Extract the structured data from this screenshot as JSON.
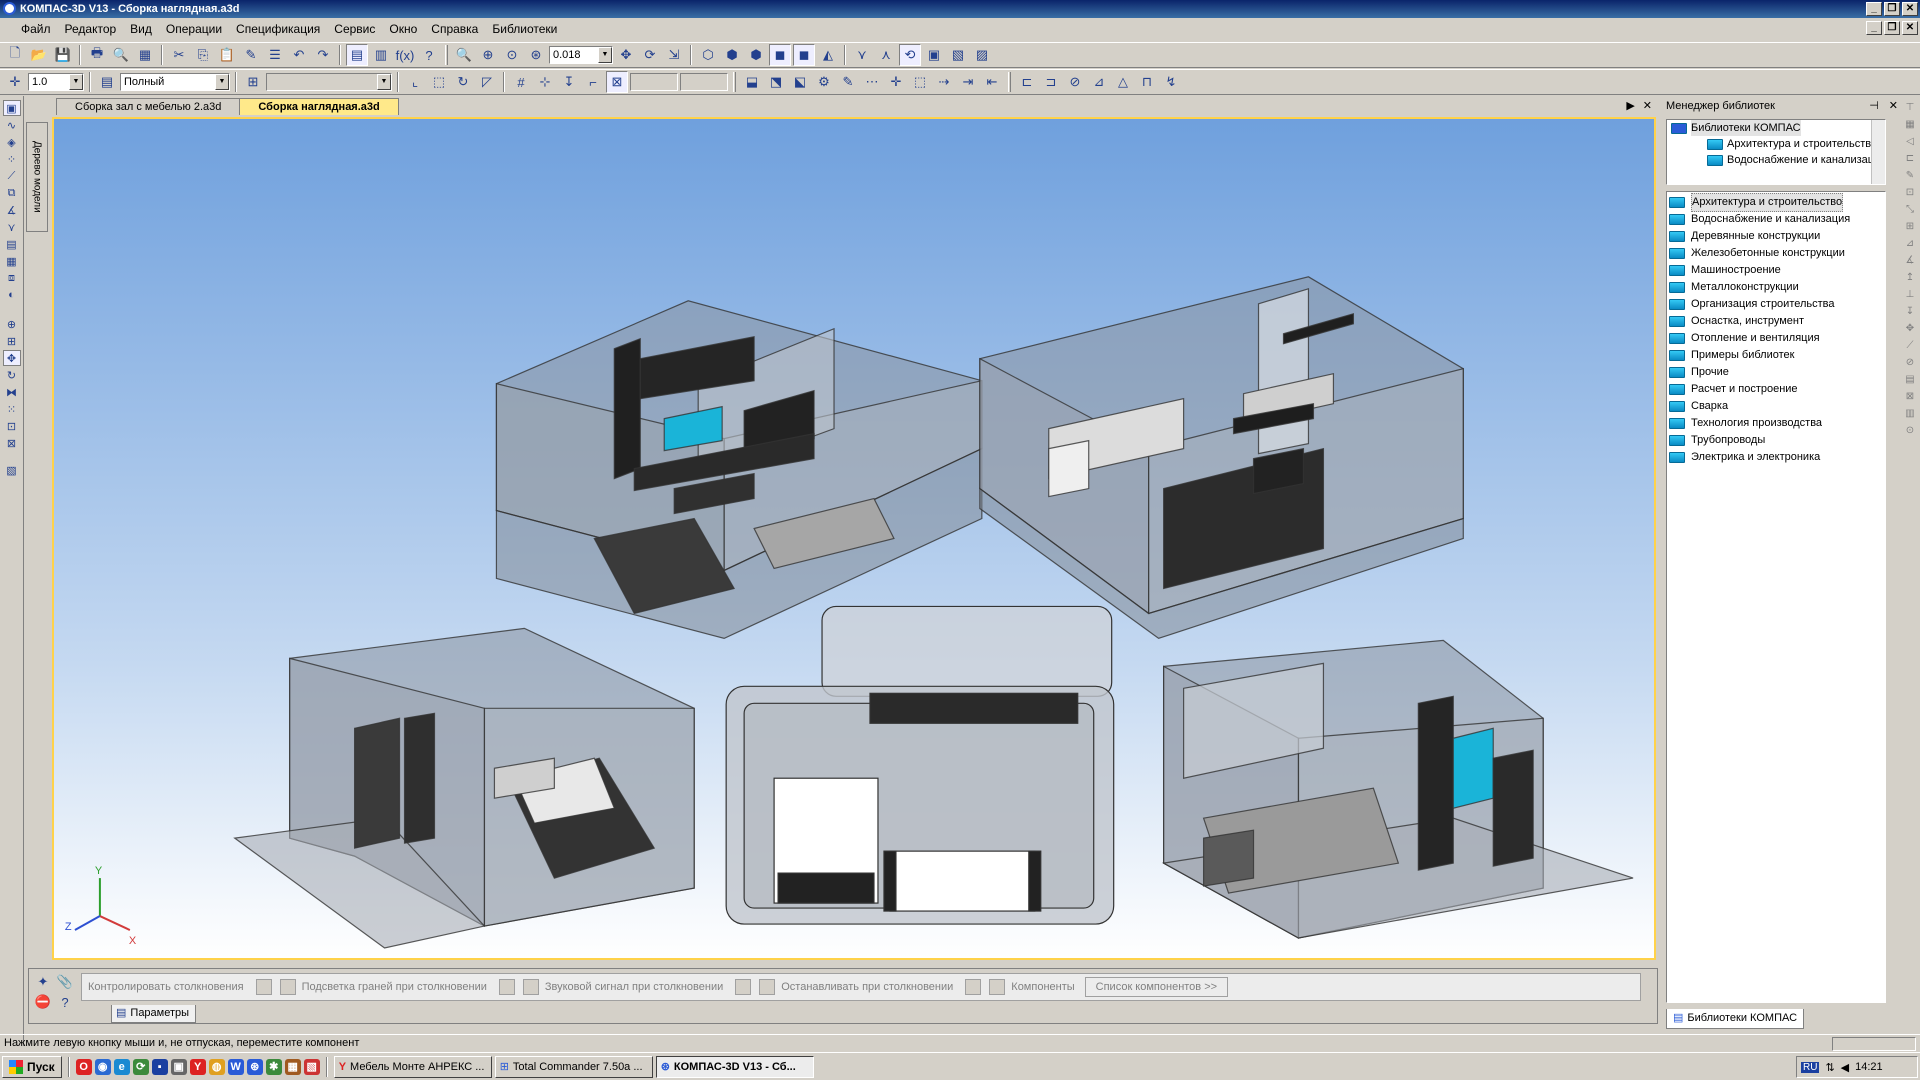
{
  "window": {
    "title": "КОМПАС-3D V13 - Сборка наглядная.a3d"
  },
  "menu": [
    "Файл",
    "Редактор",
    "Вид",
    "Операции",
    "Спецификация",
    "Сервис",
    "Окно",
    "Справка",
    "Библиотеки"
  ],
  "toolbar": {
    "zoom_value": "0.018",
    "step_value": "1.0",
    "style_value": "Полный"
  },
  "tabs": [
    {
      "label": "Сборка зал с мебелью 2.a3d",
      "active": false
    },
    {
      "label": "Сборка наглядная.a3d",
      "active": true
    }
  ],
  "tree_tab_label": "Дерево модели",
  "axes": {
    "x": "X",
    "y": "Y",
    "z": "Z"
  },
  "collision": {
    "options": [
      "Контролировать столкновения",
      "Подсветка граней при столкновении",
      "Звуковой сигнал при столкновении",
      "Останавливать при столкновении",
      "Компоненты"
    ],
    "list_button": "Список компонентов  >>",
    "params_tab": "Параметры"
  },
  "library": {
    "title": "Менеджер библиотек",
    "tree": [
      {
        "label": "Библиотеки КОМПАС",
        "level": 0
      },
      {
        "label": "Архитектура и строительство",
        "level": 1
      },
      {
        "label": "Водоснабжение и канализация",
        "level": 1
      }
    ],
    "items": [
      "Архитектура и строительство",
      "Водоснабжение и канализация",
      "Деревянные конструкции",
      "Железобетонные конструкции",
      "Машиностроение",
      "Металлоконструкции",
      "Организация строительства",
      "Оснастка, инструмент",
      "Отопление и вентиляция",
      "Примеры библиотек",
      "Прочие",
      "Расчет и построение",
      "Сварка",
      "Технология производства",
      "Трубопроводы",
      "Электрика и электроника"
    ],
    "bottom_tab": "Библиотеки КОМПАС"
  },
  "status": {
    "message": "Нажмите левую кнопку мыши и, не отпуская, переместите компонент"
  },
  "taskbar": {
    "start": "Пуск",
    "tasks": [
      {
        "label": "Мебель Монте АНРЕКС ...",
        "active": false
      },
      {
        "label": "Total Commander 7.50a ...",
        "active": false
      },
      {
        "label": "КОМПАС-3D V13 - Сб...",
        "active": true
      }
    ],
    "lang": "RU",
    "clock": "14:21"
  },
  "colors": {
    "accent": "#ffd24a",
    "viewport_top": "#6fa0dd",
    "screen_cyan": "#1ab4d8"
  }
}
